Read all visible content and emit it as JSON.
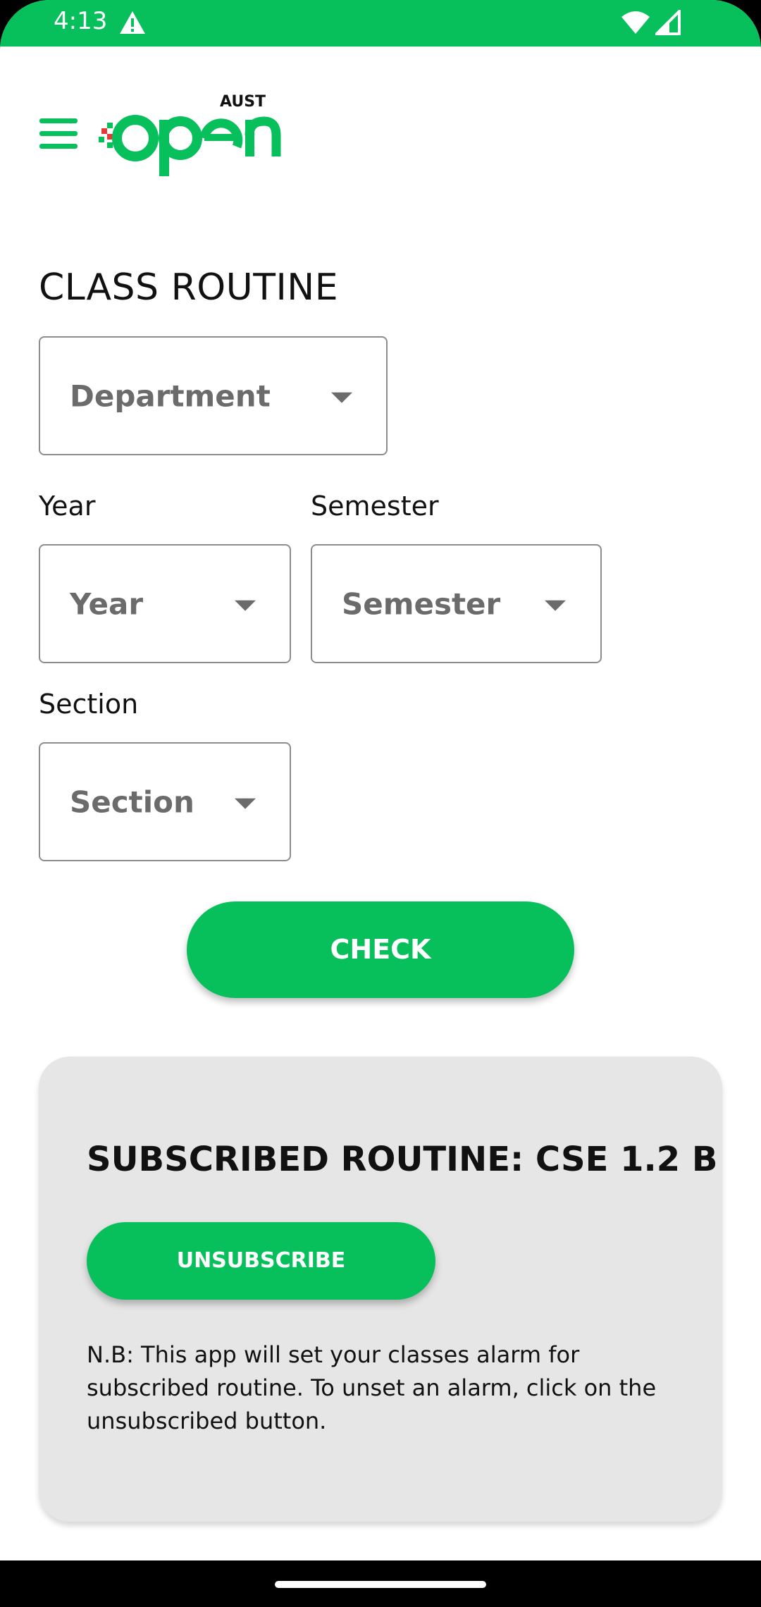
{
  "status_bar": {
    "time": "4:13",
    "alert_icon": "warning-triangle-icon",
    "wifi_icon": "wifi-icon",
    "signal_icon": "cell-signal-icon",
    "background_color": "#07bf5b"
  },
  "header": {
    "menu_icon": "hamburger-menu-icon",
    "logo_superscript": "AUST",
    "logo_text": "open",
    "brand_color": "#07bf5b",
    "accent_color": "#e53935"
  },
  "page": {
    "title": "CLASS ROUTINE"
  },
  "form": {
    "department": {
      "placeholder": "Department"
    },
    "year": {
      "label": "Year",
      "placeholder": "Year"
    },
    "semester": {
      "label": "Semester",
      "placeholder": "Semester"
    },
    "section": {
      "label": "Section",
      "placeholder": "Section"
    },
    "check_button_label": "CHECK"
  },
  "subscription": {
    "title": "SUBSCRIBED ROUTINE: CSE 1.2 B",
    "unsubscribe_label": "UNSUBSCRIBE",
    "note": "N.B: This app will set your classes alarm for subscribed routine. To unset an alarm, click on the unsubscribed button."
  }
}
